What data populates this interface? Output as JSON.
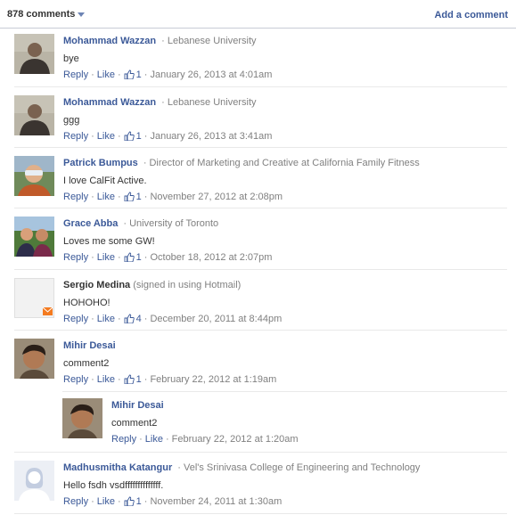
{
  "header": {
    "count_label": "878 comments",
    "add_label": "Add a comment"
  },
  "actions": {
    "reply": "Reply",
    "like": "Like"
  },
  "comments": [
    {
      "author": "Mohammad Wazzan",
      "affiliation": "Lebanese University",
      "text": "bye",
      "likes": "1",
      "date": "January 26, 2013 at 4:01am",
      "avatar": "photo-dark"
    },
    {
      "author": "Mohammad Wazzan",
      "affiliation": "Lebanese University",
      "text": "ggg",
      "likes": "1",
      "date": "January 26, 2013 at 3:41am",
      "avatar": "photo-dark"
    },
    {
      "author": "Patrick Bumpus",
      "affiliation_pre": "Director of Marketing and Creative at",
      "affiliation_link": "California Family Fitness",
      "text": "I love CalFit Active.",
      "likes": "1",
      "date": "November 27, 2012 at 2:08pm",
      "avatar": "photo-sunglasses"
    },
    {
      "author": "Grace Abba",
      "affiliation": "University of Toronto",
      "text": "Loves me some GW!",
      "likes": "1",
      "date": "October 18, 2012 at 2:07pm",
      "avatar": "photo-group"
    },
    {
      "author": "Sergio Medina",
      "affiliation": "(signed in using Hotmail)",
      "text": "HOHOHO!",
      "likes": "4",
      "date": "December 20, 2011 at 8:44pm",
      "avatar": "hotmail-placeholder"
    },
    {
      "author": "Mihir Desai",
      "text": "comment2",
      "likes": "1",
      "date": "February 22, 2012 at 1:19am",
      "avatar": "photo-face"
    },
    {
      "author": "Mihir Desai",
      "text": "comment2",
      "date": "February 22, 2012 at 1:20am",
      "avatar": "photo-face"
    },
    {
      "author": "Madhusmitha Katangur",
      "affiliation": "Vel's Srinivasa College of Engineering and Technology",
      "text": "Hello fsdh vsdffffffffffffff.",
      "likes": "1",
      "date": "November 24, 2011 at 1:30am",
      "avatar": "silhouette-female"
    }
  ],
  "colors": {
    "link": "#3b5998",
    "meta": "#808080",
    "separator": "#e9e9e9"
  }
}
